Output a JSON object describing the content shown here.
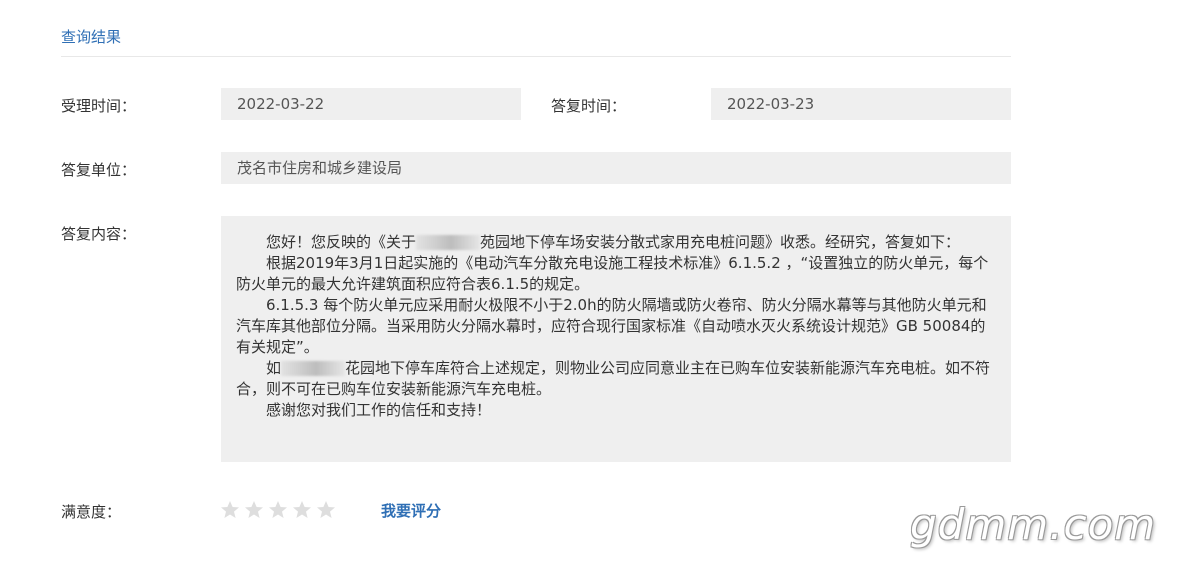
{
  "section": {
    "title": "查询结果"
  },
  "fields": {
    "accept_time_label": "受理时间：",
    "accept_time_value": "2022-03-22",
    "reply_time_label": "答复时间：",
    "reply_time_value": "2022-03-23",
    "reply_unit_label": "答复单位：",
    "reply_unit_value": "茂名市住房和城乡建设局",
    "reply_content_label": "答复内容："
  },
  "content": {
    "p1_pre": "您好！您反映的《关于",
    "p1_post": "苑园地下停车场安装分散式家用充电桩问题》收悉。经研究，答复如下：",
    "p2": "根据2019年3月1日起实施的《电动汽车分散充电设施工程技术标准》6.1.5.2 ，“设置独立的防火单元，每个防火单元的最大允许建筑面积应符合表6.1.5的规定。",
    "p3": "6.1.5.3 每个防火单元应采用耐火极限不小于2.0h的防火隔墙或防火卷帘、防火分隔水幕等与其他防火单元和汽车库其他部位分隔。当采用防火分隔水幕时，应符合现行国家标准《自动喷水灭火系统设计规范》GB 50084的有关规定”。",
    "p4_pre": "如",
    "p4_post": "花园地下停车库符合上述规定，则物业公司应同意业主在已购车位安装新能源汽车充电桩。如不符合，则不可在已购车位安装新能源汽车充电桩。",
    "p5": "感谢您对我们工作的信任和支持！"
  },
  "rating": {
    "label": "满意度：",
    "stars_total": 5,
    "stars_filled": 0,
    "link_label": "我要评分"
  },
  "watermark": {
    "text": "gdmm.com"
  },
  "colors": {
    "accent": "#2f6fb5",
    "field_bg": "#efefef",
    "star": "#dedede"
  }
}
